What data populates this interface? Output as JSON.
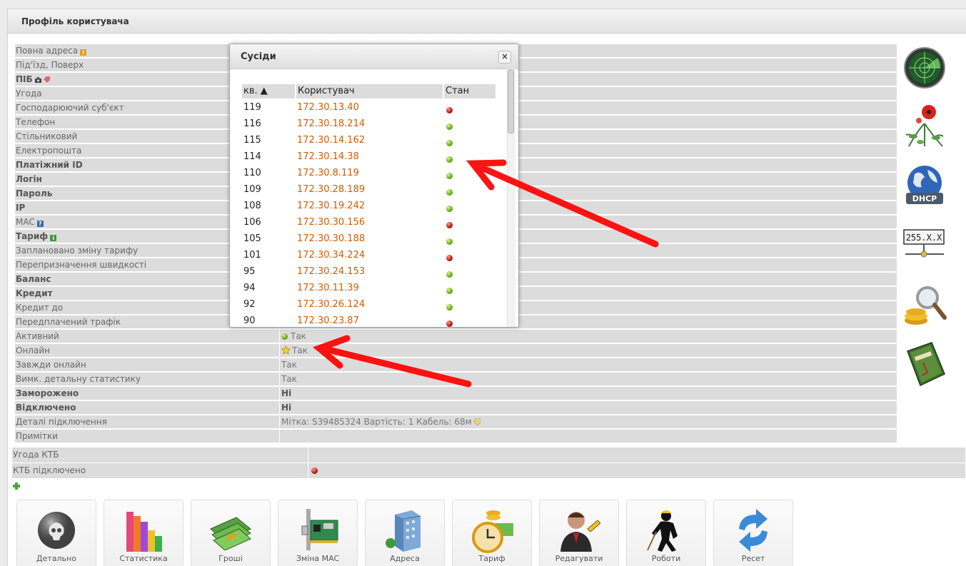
{
  "panel": {
    "title": "Профіль користувача"
  },
  "fields": [
    {
      "label": "Повна адреса",
      "bold": false,
      "icon": "warning-icon",
      "value": ""
    },
    {
      "label": "Під'їзд, Поверх",
      "bold": false,
      "value": ""
    },
    {
      "label": "ПІБ",
      "bold": true,
      "icon": "camera-icon",
      "value": ""
    },
    {
      "label": "Угода",
      "bold": false,
      "value": ""
    },
    {
      "label": "Господарюючий суб'єкт",
      "bold": false,
      "value": ""
    },
    {
      "label": "Телефон",
      "bold": false,
      "value": ""
    },
    {
      "label": "Стільниковий",
      "bold": false,
      "value": ""
    },
    {
      "label": "Електропошта",
      "bold": false,
      "value": ""
    },
    {
      "label": "Платіжний ID",
      "bold": true,
      "value": ""
    },
    {
      "label": "Логін",
      "bold": true,
      "value": ""
    },
    {
      "label": "Пароль",
      "bold": true,
      "value": ""
    },
    {
      "label": "IP",
      "bold": true,
      "value": ""
    },
    {
      "label": "MAC",
      "bold": false,
      "icon": "help-icon",
      "value": ""
    },
    {
      "label": "Тариф",
      "bold": true,
      "icon": "info-icon",
      "value": ""
    },
    {
      "label": "Заплановано зміну тарифу",
      "bold": false,
      "value": ""
    },
    {
      "label": "Перепризначення швидкості",
      "bold": false,
      "value": ""
    },
    {
      "label": "Баланс",
      "bold": true,
      "value": ""
    },
    {
      "label": "Кредит",
      "bold": true,
      "value": ""
    },
    {
      "label": "Кредит до",
      "bold": false,
      "value": ""
    },
    {
      "label": "Передплачений трафік",
      "bold": false,
      "value": ""
    },
    {
      "label": "Активний",
      "bold": false,
      "value": "Так",
      "value_icon": "green-dot-icon"
    },
    {
      "label": "Онлайн",
      "bold": false,
      "value": "Так",
      "value_icon": "star-icon"
    },
    {
      "label": "Завжди онлайн",
      "bold": false,
      "value": "Так"
    },
    {
      "label": "Вимк. детальну статистику",
      "bold": false,
      "value": "Так"
    },
    {
      "label": "Заморожено",
      "bold": true,
      "value": "Ні",
      "value_bold": true
    },
    {
      "label": "Відключено",
      "bold": true,
      "value": "Ні",
      "value_bold": true
    },
    {
      "label": "Деталі підключення",
      "bold": false,
      "value": "Мітка: S39485324 Вартість: 1 Кабель: 68м",
      "value_icon_after": "tag-icon"
    },
    {
      "label": "Примітки",
      "bold": false,
      "value": ""
    }
  ],
  "ktb": [
    {
      "label": "Угода КТБ",
      "value": ""
    },
    {
      "label": "КТБ підключено",
      "value_icon": "red-dot-icon"
    }
  ],
  "side_icons": [
    "radar-icon",
    "flower-icon",
    "dhcp-globe-icon",
    "ip-mask-icon",
    "coins-magnifier-icon",
    "pension-book-icon"
  ],
  "side_icon_text": {
    "dhcp": "DHCP",
    "mask": "255.X.X"
  },
  "toolbar": [
    {
      "label": "Детально",
      "icon": "skull-icon"
    },
    {
      "label": "Статистика",
      "icon": "bar-chart-icon"
    },
    {
      "label": "Гроші",
      "icon": "money-icon"
    },
    {
      "label": "Зміна MAC",
      "icon": "network-card-icon"
    },
    {
      "label": "Адреса",
      "icon": "building-icon"
    },
    {
      "label": "Тариф",
      "icon": "clock-coins-icon"
    },
    {
      "label": "Редагувати",
      "icon": "user-edit-icon"
    },
    {
      "label": "Роботи",
      "icon": "worker-icon"
    },
    {
      "label": "Ресет",
      "icon": "refresh-icon"
    }
  ],
  "dialog": {
    "title": "Сусіди",
    "close_label": "×",
    "columns": {
      "kv": "кв. ▲",
      "user": "Користувач",
      "state": "Стан"
    },
    "rows": [
      {
        "kv": "119",
        "ip": "172.30.13.40",
        "state": "offline"
      },
      {
        "kv": "116",
        "ip": "172.30.18.214",
        "state": "online"
      },
      {
        "kv": "115",
        "ip": "172.30.14.162",
        "state": "online"
      },
      {
        "kv": "114",
        "ip": "172.30.14.38",
        "state": "online"
      },
      {
        "kv": "110",
        "ip": "172.30.8.119",
        "state": "online"
      },
      {
        "kv": "109",
        "ip": "172.30.28.189",
        "state": "online"
      },
      {
        "kv": "108",
        "ip": "172.30.19.242",
        "state": "online"
      },
      {
        "kv": "106",
        "ip": "172.30.30.156",
        "state": "offline"
      },
      {
        "kv": "105",
        "ip": "172.30.30.188",
        "state": "online"
      },
      {
        "kv": "101",
        "ip": "172.30.34.224",
        "state": "offline"
      },
      {
        "kv": "95",
        "ip": "172.30.24.153",
        "state": "online"
      },
      {
        "kv": "94",
        "ip": "172.30.11.39",
        "state": "online"
      },
      {
        "kv": "92",
        "ip": "172.30.26.124",
        "state": "online"
      },
      {
        "kv": "90",
        "ip": "172.30.23.87",
        "state": "offline"
      }
    ]
  },
  "colors": {
    "ip_link": "#d35b00",
    "annotation_arrow": "#ff0000",
    "row_bg": "#dcdcdc"
  }
}
